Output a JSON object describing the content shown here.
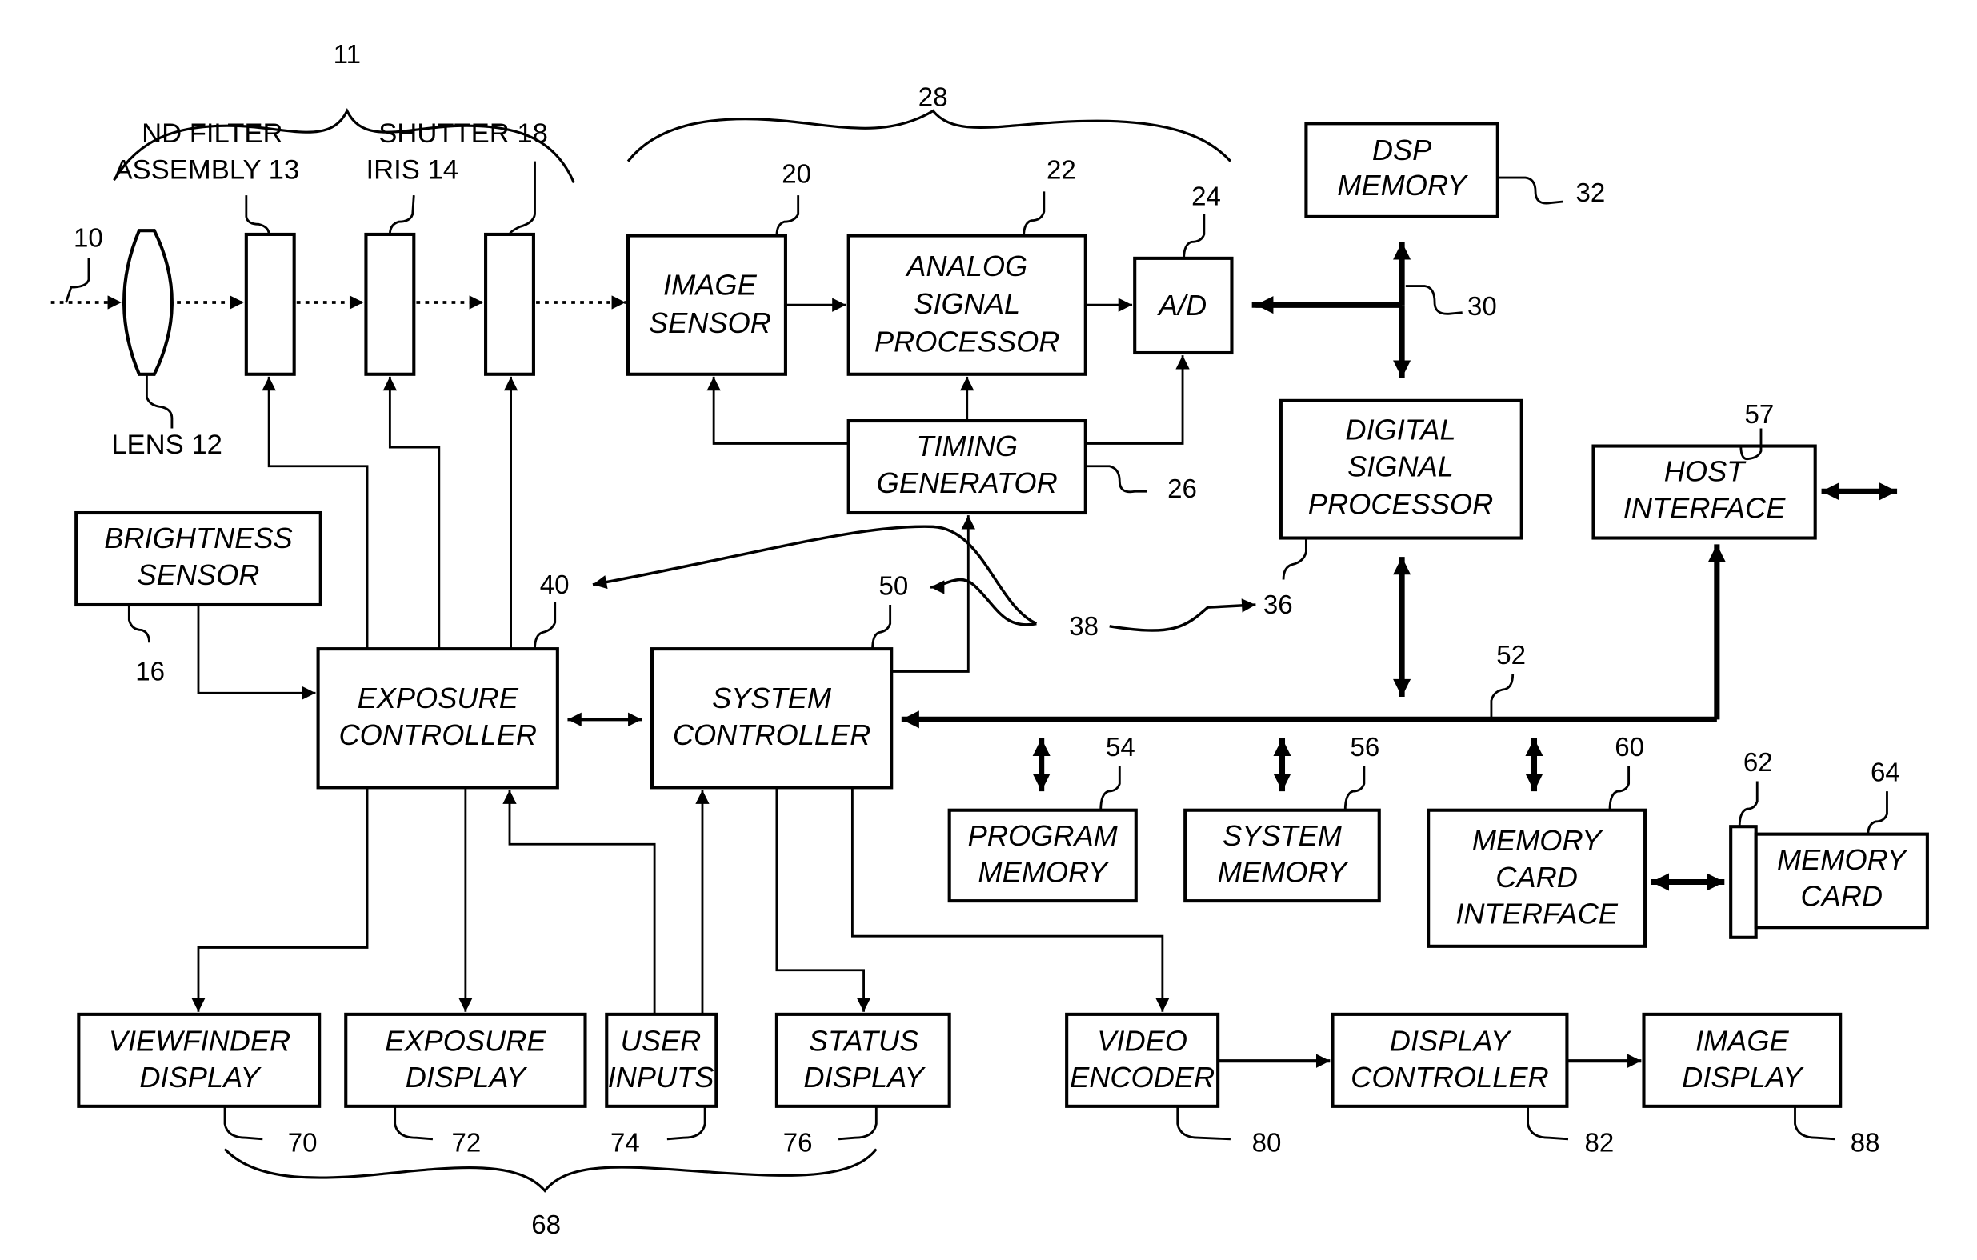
{
  "figure": {
    "blocks": {
      "nd_filter": {
        "label": "ND FILTER",
        "label2": "ASSEMBLY 13"
      },
      "iris": {
        "label": "IRIS 14"
      },
      "shutter": {
        "label": "SHUTTER 18"
      },
      "lens": {
        "label": "LENS 12"
      },
      "image_sensor": {
        "l1": "IMAGE",
        "l2": "SENSOR"
      },
      "analog_signal_processor": {
        "l1": "ANALOG",
        "l2": "SIGNAL",
        "l3": "PROCESSOR"
      },
      "ad": {
        "l1": "A/D"
      },
      "dsp_memory": {
        "l1": "DSP",
        "l2": "MEMORY"
      },
      "timing_generator": {
        "l1": "TIMING",
        "l2": "GENERATOR"
      },
      "digital_signal_processor": {
        "l1": "DIGITAL",
        "l2": "SIGNAL",
        "l3": "PROCESSOR"
      },
      "host_interface": {
        "l1": "HOST",
        "l2": "INTERFACE"
      },
      "brightness_sensor": {
        "l1": "BRIGHTNESS",
        "l2": "SENSOR"
      },
      "exposure_controller": {
        "l1": "EXPOSURE",
        "l2": "CONTROLLER"
      },
      "system_controller": {
        "l1": "SYSTEM",
        "l2": "CONTROLLER"
      },
      "program_memory": {
        "l1": "PROGRAM",
        "l2": "MEMORY"
      },
      "system_memory": {
        "l1": "SYSTEM",
        "l2": "MEMORY"
      },
      "memory_card_interface": {
        "l1": "MEMORY",
        "l2": "CARD",
        "l3": "INTERFACE"
      },
      "memory_card": {
        "l1": "MEMORY",
        "l2": "CARD"
      },
      "viewfinder_display": {
        "l1": "VIEWFINDER",
        "l2": "DISPLAY"
      },
      "exposure_display": {
        "l1": "EXPOSURE",
        "l2": "DISPLAY"
      },
      "user_inputs": {
        "l1": "USER",
        "l2": "INPUTS"
      },
      "status_display": {
        "l1": "STATUS",
        "l2": "DISPLAY"
      },
      "video_encoder": {
        "l1": "VIDEO",
        "l2": "ENCODER"
      },
      "display_controller": {
        "l1": "DISPLAY",
        "l2": "CONTROLLER"
      },
      "image_display": {
        "l1": "IMAGE",
        "l2": "DISPLAY"
      }
    },
    "refs": {
      "r10": "10",
      "r11": "11",
      "r16": "16",
      "r20": "20",
      "r22": "22",
      "r24": "24",
      "r26": "26",
      "r28": "28",
      "r30": "30",
      "r32": "32",
      "r36": "36",
      "r38": "38",
      "r40a": "40",
      "r40b": "40",
      "r50a": "50",
      "r50b": "50",
      "r52": "52",
      "r54": "54",
      "r56": "56",
      "r57": "57",
      "r60": "60",
      "r62": "62",
      "r64": "64",
      "r68": "68",
      "r70": "70",
      "r72": "72",
      "r74": "74",
      "r76": "76",
      "r80": "80",
      "r82": "82",
      "r88": "88"
    }
  }
}
